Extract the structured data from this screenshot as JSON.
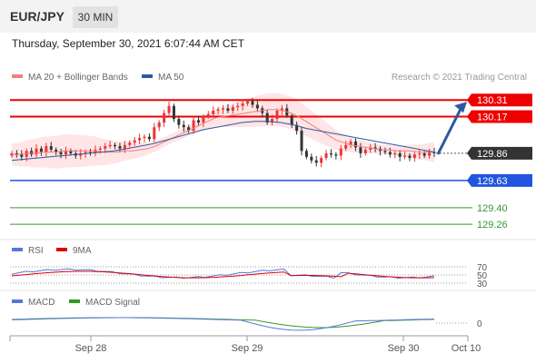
{
  "header": {
    "symbol": "EUR/JPY",
    "timeframe": "30 MIN"
  },
  "datetime": "Thursday, September 30, 2021 6:07:44 AM CET",
  "legend": {
    "price": [
      {
        "label": "MA 20 + Bollinger Bands",
        "color": "#f08080"
      },
      {
        "label": "MA 50",
        "color": "#2c5aa0"
      }
    ],
    "rsi": [
      {
        "label": "RSI",
        "color": "#5577dd"
      },
      {
        "label": "9MA",
        "color": "#dd0000"
      }
    ],
    "macd": [
      {
        "label": "MACD",
        "color": "#5577dd"
      },
      {
        "label": "MACD Signal",
        "color": "#339922"
      }
    ]
  },
  "copyright": "Research © 2021 Trading Central",
  "colors": {
    "resistance": "#ee0000",
    "support": "#2255dd",
    "target": "#339933",
    "bull_candle": "#ee3333",
    "bear_candle": "#333333",
    "band_fill": "#ffdede",
    "current": "#333333"
  },
  "levels": [
    {
      "value": "130.31",
      "kind": "resistance"
    },
    {
      "value": "130.17",
      "kind": "resistance"
    },
    {
      "value": "129.86",
      "kind": "current"
    },
    {
      "value": "129.63",
      "kind": "support"
    },
    {
      "value": "129.40",
      "kind": "target"
    },
    {
      "value": "129.26",
      "kind": "target"
    }
  ],
  "rsi_levels": [
    "70",
    "50",
    "30"
  ],
  "macd_zero": "0",
  "xaxis": [
    "Sep 28",
    "Sep 29",
    "Sep 30",
    "Oct 10"
  ],
  "chart_data": {
    "type": "candlestick",
    "symbol": "EUR/JPY",
    "interval": "30 MIN",
    "ylim": [
      129.2,
      130.35
    ],
    "close": [
      129.86,
      129.85,
      129.83,
      129.88,
      129.85,
      129.9,
      129.87,
      129.92,
      129.89,
      129.87,
      129.85,
      129.88,
      129.86,
      129.84,
      129.86,
      129.87,
      129.86,
      129.89,
      129.9,
      129.92,
      129.93,
      129.92,
      129.9,
      129.93,
      129.95,
      129.97,
      129.99,
      130.0,
      129.98,
      130.08,
      130.12,
      130.2,
      130.26,
      130.15,
      130.1,
      130.08,
      130.05,
      130.14,
      130.12,
      130.17,
      130.19,
      130.22,
      130.23,
      130.24,
      130.22,
      130.25,
      130.26,
      130.28,
      130.3,
      130.27,
      130.24,
      130.2,
      130.12,
      130.15,
      130.22,
      130.24,
      130.18,
      130.1,
      130.05,
      129.88,
      129.83,
      129.8,
      129.78,
      129.82,
      129.86,
      129.85,
      129.84,
      129.9,
      129.93,
      129.96,
      129.91,
      129.86,
      129.89,
      129.91,
      129.9,
      129.88,
      129.87,
      129.85,
      129.86,
      129.83,
      129.84,
      129.82,
      129.85,
      129.86,
      129.84,
      129.87,
      129.86
    ],
    "ma20": [
      129.85,
      129.85,
      129.86,
      129.86,
      129.87,
      129.87,
      129.87,
      129.88,
      129.88,
      129.88,
      129.88,
      129.88,
      129.87,
      129.87,
      129.87,
      129.88,
      129.88,
      129.89,
      129.9,
      129.92,
      129.95,
      129.98,
      130.01,
      130.04,
      130.07,
      130.1,
      130.13,
      130.16,
      130.17,
      130.18,
      130.19,
      130.2,
      130.21,
      130.22,
      130.23,
      130.23,
      130.22,
      130.2,
      130.17,
      130.13,
      130.09,
      130.05,
      130.01,
      129.97,
      129.95,
      129.93,
      129.92,
      129.91,
      129.9,
      129.89,
      129.89,
      129.88,
      129.88,
      129.88,
      129.87,
      129.87,
      129.87
    ],
    "ma50": [
      129.8,
      129.81,
      129.82,
      129.83,
      129.84,
      129.85,
      129.86,
      129.87,
      129.88,
      129.9,
      129.92,
      129.94,
      129.97,
      130.0,
      130.03,
      130.06,
      130.08,
      130.1,
      130.12,
      130.13,
      130.13,
      130.12,
      130.1,
      130.07,
      130.05,
      130.03,
      130.01,
      129.99,
      129.97,
      129.95,
      129.93,
      129.91,
      129.89,
      129.87
    ],
    "levels": {
      "resistance": [
        130.31,
        130.17
      ],
      "current": 129.86,
      "support": [
        129.63
      ],
      "targets": [
        129.4,
        129.26
      ]
    },
    "rsi": {
      "levels": [
        70,
        50,
        30
      ]
    },
    "macd": {
      "zero_line": 0
    }
  }
}
